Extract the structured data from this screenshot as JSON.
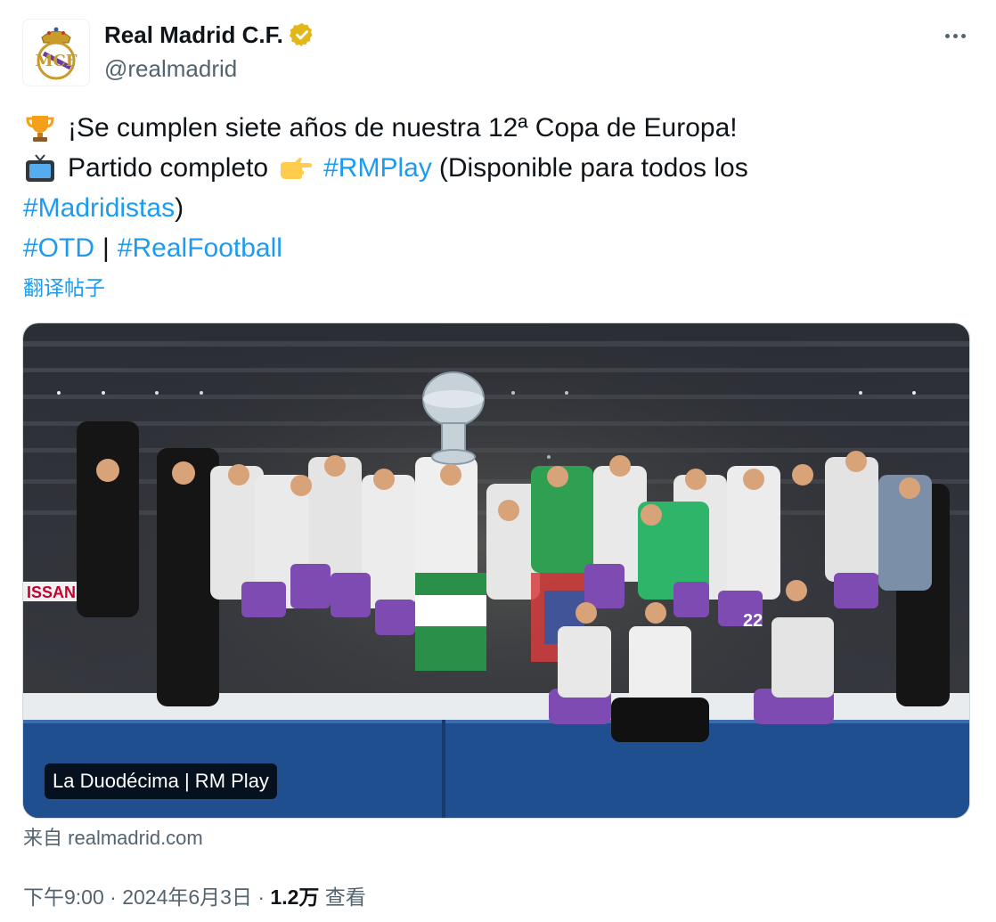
{
  "author": {
    "display_name": "Real Madrid C.F.",
    "handle": "@realmadrid",
    "avatar_icon": "real-madrid-crest-icon",
    "verified_icon": "verified-badge-icon",
    "verified_color": "#e2b719"
  },
  "tweet": {
    "line1_text": "¡Se cumplen siete años de nuestra 12ª Copa de Europa!",
    "line1_icon": "trophy-icon",
    "line2_icon": "tv-icon",
    "line2_text": "Partido completo",
    "line2_pointer_icon": "pointing-hand-icon",
    "hashtag_rmplay": "#RMPlay",
    "line2_suffix": "(Disponible para todos los",
    "hashtag_madridistas": "#Madridistas",
    "line3_suffix": ")",
    "hashtag_otd": "#OTD",
    "separator": "|",
    "hashtag_realfootball": "#RealFootball",
    "translate_label": "翻译帖子",
    "hashtag_color": "#1d9bf0"
  },
  "media": {
    "caption": "La Duodécima | RM Play",
    "board_text": "ISSAN",
    "player_number": "22"
  },
  "source": {
    "prefix": "来自",
    "domain": "realmadrid.com"
  },
  "meta": {
    "time": "下午9:00",
    "dot1": "·",
    "date": "2024年6月3日",
    "dot2": "·",
    "views": "1.2万",
    "views_label": "查看"
  }
}
